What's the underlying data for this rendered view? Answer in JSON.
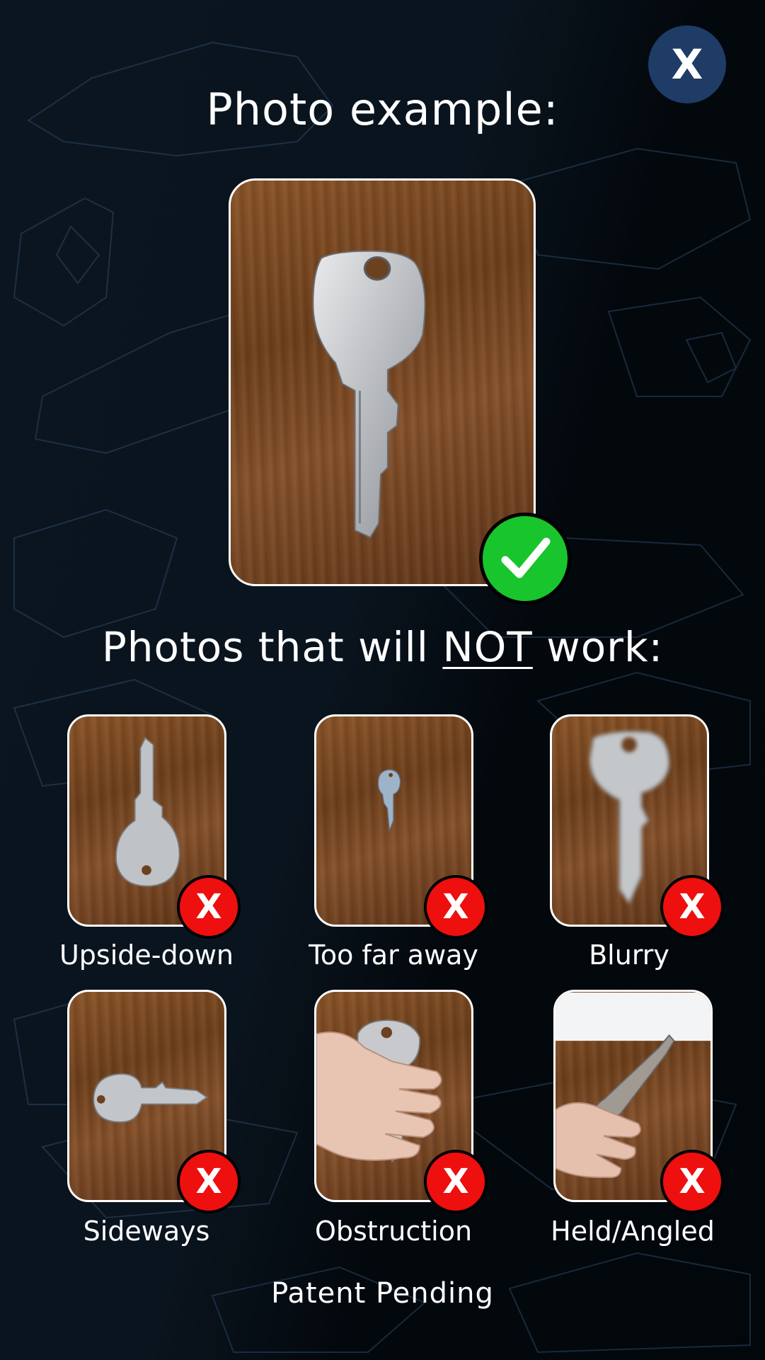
{
  "close_button": {
    "label": "X",
    "icon": "close-icon"
  },
  "example": {
    "title": "Photo example:",
    "badge_icon": "checkmark-icon",
    "badge_color": "#19c52c"
  },
  "bad_section": {
    "title_before": "Photos that will ",
    "title_emphasis": "NOT",
    "title_after": " work:"
  },
  "bad_examples": [
    {
      "caption": "Upside-down",
      "badge": "X"
    },
    {
      "caption": "Too far away",
      "badge": "X"
    },
    {
      "caption": "Blurry",
      "badge": "X"
    },
    {
      "caption": "Sideways",
      "badge": "X"
    },
    {
      "caption": "Obstruction",
      "badge": "X"
    },
    {
      "caption": "Held/Angled",
      "badge": "X"
    }
  ],
  "footer": {
    "patent": "Patent Pending"
  },
  "colors": {
    "background": "#050b12",
    "close_button": "#1e3c66",
    "ok_badge": "#19c52c",
    "reject_badge": "#ee0f0f",
    "text": "#ffffff"
  }
}
